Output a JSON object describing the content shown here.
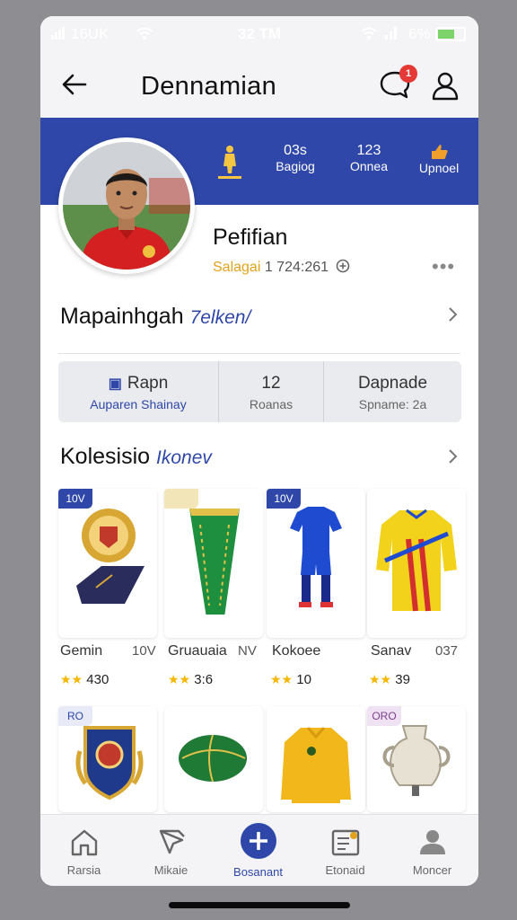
{
  "status_bar": {
    "carrier": "16UK",
    "time": "32 TM",
    "battery": "6%"
  },
  "header": {
    "title": "Dennamian",
    "notification_count": "1"
  },
  "banner": {
    "stats": [
      {
        "value": "",
        "label": ""
      },
      {
        "value": "03s",
        "label": "Bagiog"
      },
      {
        "value": "123",
        "label": "Onnea"
      },
      {
        "value": "",
        "label": "Upnoel"
      }
    ]
  },
  "profile": {
    "name": "Pefifian",
    "sub_highlight": "Salagai",
    "sub_detail": "1 724:261",
    "more": "•••"
  },
  "section_main": {
    "title": "Mapainhgah",
    "tag": "7elken/"
  },
  "stats_box": [
    {
      "top": "Rapn",
      "bottom": "Auparen Shainay"
    },
    {
      "top": "12",
      "bottom": "Roanas"
    },
    {
      "top": "Dapnade",
      "bottom": "Spname: 2a"
    }
  ],
  "section_collection": {
    "title": "Kolesisio",
    "tag": "Ikonev"
  },
  "items_row1": [
    {
      "tag": "10V",
      "name": "Gemin",
      "num": "10V",
      "rating": "430"
    },
    {
      "tag": "",
      "name": "Gruauaia",
      "num": "NV",
      "rating": "3:6"
    },
    {
      "tag": "10V",
      "name": "Kokoee",
      "num": "",
      "rating": "10"
    },
    {
      "tag": "",
      "name": "Sanav",
      "num": "037",
      "rating": "39"
    }
  ],
  "items_row2": [
    {
      "tag": "RO"
    },
    {
      "tag": ""
    },
    {
      "tag": ""
    },
    {
      "tag": "ORO"
    }
  ],
  "nav": [
    {
      "label": "Rarsia"
    },
    {
      "label": "Mikaie"
    },
    {
      "label": "Bosanant"
    },
    {
      "label": "Etonaid"
    },
    {
      "label": "Moncer"
    }
  ],
  "colors": {
    "accent": "#2f47a8",
    "badge": "#e53935",
    "star": "#f5b700"
  }
}
